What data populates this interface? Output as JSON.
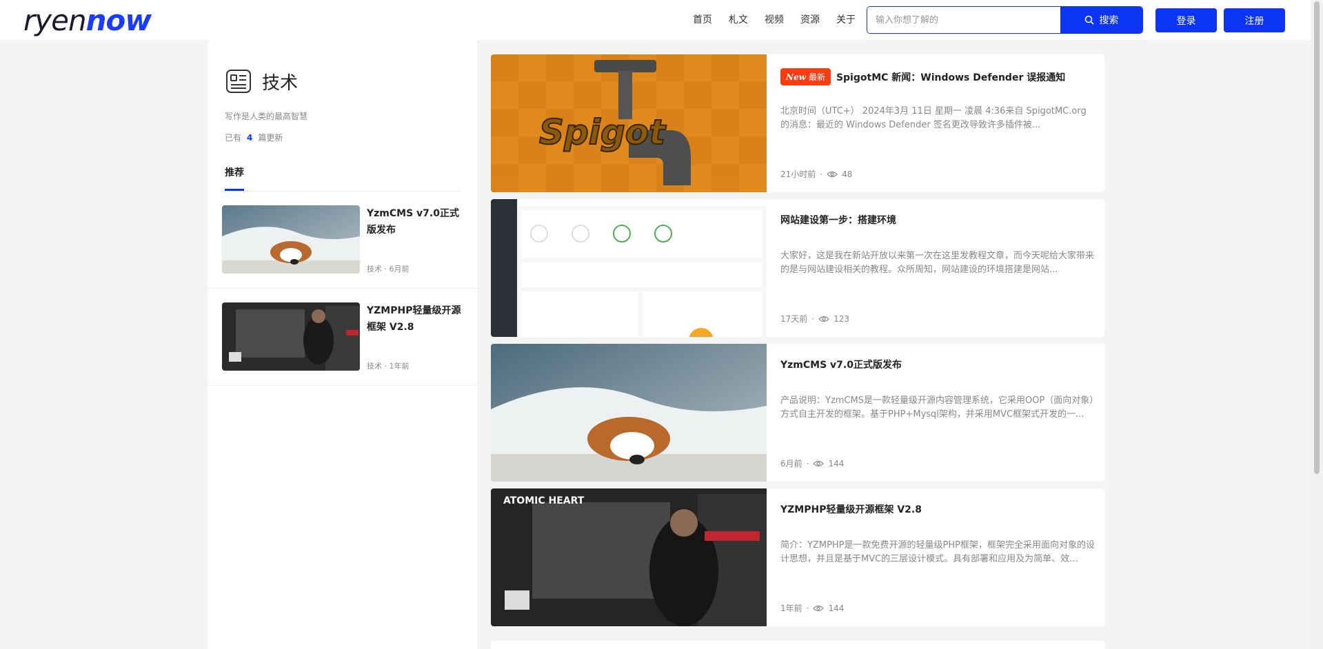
{
  "header": {
    "logo_left": "ryen",
    "logo_right": "now",
    "nav": [
      "首页",
      "札文",
      "视频",
      "资源",
      "关于"
    ],
    "search_placeholder": "输入你想了解的",
    "search_button": "搜索",
    "login": "登录",
    "register": "注册",
    "accent_color": "#0c34f5"
  },
  "sidebar": {
    "category_title": "技术",
    "category_desc": "写作是人类的最高智慧",
    "count_prefix": "已有",
    "count_value": "4",
    "count_suffix": "篇更新",
    "tab_label": "推荐",
    "items": [
      {
        "title": "YzmCMS v7.0正式版发布",
        "meta": "技术 · 6月前"
      },
      {
        "title": "YZMPHP轻量级开源框架 V2.8",
        "meta": "技术 · 1年前"
      }
    ]
  },
  "articles": [
    {
      "badge_icon": "New",
      "badge": "最新",
      "title": "SpigotMC 新闻：Windows Defender 误报通知",
      "excerpt": "北京时间（UTC+） 2024年3月 11日 星期一 凌晨 4:36来自 SpigotMC.org 的消息：最近的 Windows Defender 签名更改导致许多插件被...",
      "time": "21小时前",
      "views": "48",
      "thumb_text": "Spigot"
    },
    {
      "title": "网站建设第一步：搭建环境",
      "excerpt": "大家好，这是我在新站开放以来第一次在这里发教程文章，而今天呢给大家带来的是与网站建设相关的教程。众所周知，网站建设的环境搭建是网站...",
      "time": "17天前",
      "views": "123"
    },
    {
      "title": "YzmCMS v7.0正式版发布",
      "excerpt": "产品说明：YzmCMS是一款轻量级开源内容管理系统，它采用OOP（面向对象）方式自主开发的框架。基于PHP+Mysql架构，并采用MVC框架式开发的一...",
      "time": "6月前",
      "views": "144"
    },
    {
      "title": "YZMPHP轻量级开源框架 V2.8",
      "excerpt": "简介：YZMPHP是一款免费开源的轻量级PHP框架，框架完全采用面向对象的设计思想，并且是基于MVC的三层设计模式。具有部署和应用及为简单、效...",
      "time": "1年前",
      "views": "144",
      "thumb_text": "ATOMIC HEART"
    }
  ]
}
